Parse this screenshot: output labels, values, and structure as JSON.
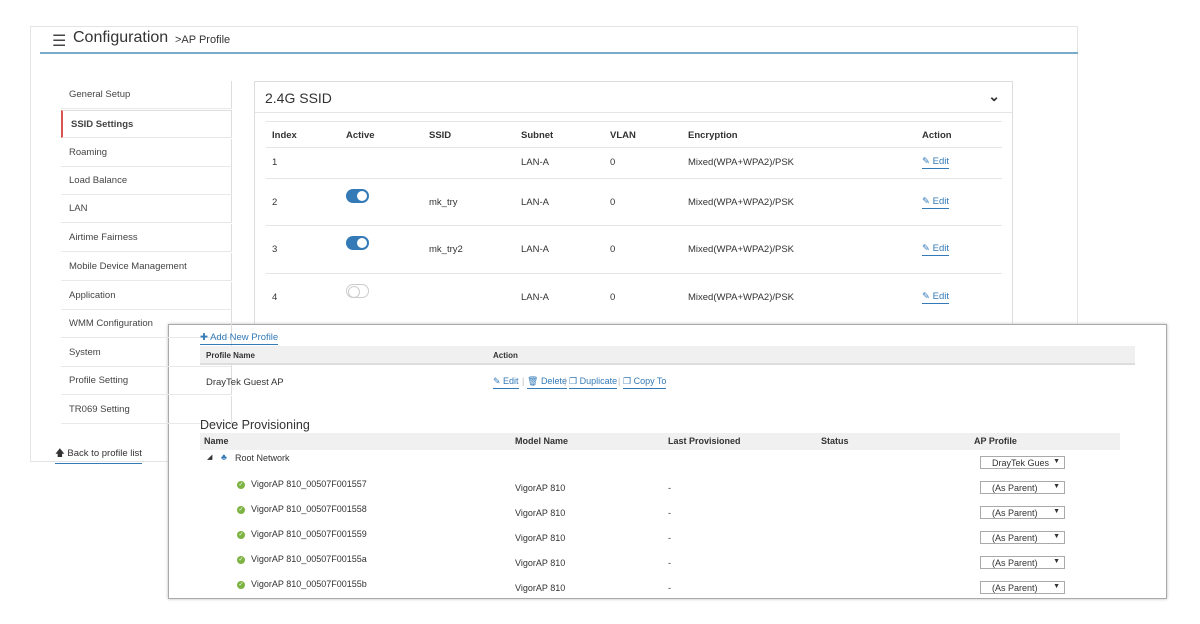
{
  "header": {
    "title": "Configuration",
    "crumb": ">AP Profile",
    "icon": "sliders-icon"
  },
  "sidebar": {
    "items": [
      "General Setup",
      "SSID Settings",
      "Roaming",
      "Load Balance",
      "LAN",
      "Airtime Fairness",
      "Mobile Device Management",
      "Application",
      "WMM Configuration",
      "System",
      "Profile Setting",
      "TR069 Setting"
    ],
    "active": 1,
    "back": "Back to profile list"
  },
  "ssid": {
    "title": "2.4G SSID",
    "columns": [
      "Index",
      "Active",
      "SSID",
      "Subnet",
      "VLAN",
      "Encryption",
      "Action"
    ],
    "rows": [
      {
        "index": "1",
        "active": null,
        "ssid": "",
        "subnet": "LAN-A",
        "vlan": "0",
        "enc": "Mixed(WPA+WPA2)/PSK",
        "action": "Edit"
      },
      {
        "index": "2",
        "active": true,
        "ssid": "mk_try",
        "subnet": "LAN-A",
        "vlan": "0",
        "enc": "Mixed(WPA+WPA2)/PSK",
        "action": "Edit"
      },
      {
        "index": "3",
        "active": true,
        "ssid": "mk_try2",
        "subnet": "LAN-A",
        "vlan": "0",
        "enc": "Mixed(WPA+WPA2)/PSK",
        "action": "Edit"
      },
      {
        "index": "4",
        "active": false,
        "ssid": "",
        "subnet": "LAN-A",
        "vlan": "0",
        "enc": "Mixed(WPA+WPA2)/PSK",
        "action": "Edit"
      }
    ]
  },
  "profiles": {
    "add": "Add New Profile",
    "columns": [
      "Profile Name",
      "Action"
    ],
    "rows": [
      {
        "name": "DrayTek Guest AP",
        "actions": [
          "Edit",
          "Delete",
          "Duplicate",
          "Copy To"
        ]
      }
    ]
  },
  "provisioning": {
    "title": "Device Provisioning",
    "columns": [
      "Name",
      "Model Name",
      "Last Provisioned",
      "Status",
      "AP Profile"
    ],
    "root": {
      "name": "Root Network",
      "profile": "DrayTek Gues"
    },
    "devices": [
      {
        "name": "VigorAP 810_00507F001557",
        "model": "VigorAP 810",
        "last": "-",
        "status": "",
        "profile": "(As Parent)"
      },
      {
        "name": "VigorAP 810_00507F001558",
        "model": "VigorAP 810",
        "last": "-",
        "status": "",
        "profile": "(As Parent)"
      },
      {
        "name": "VigorAP 810_00507F001559",
        "model": "VigorAP 810",
        "last": "-",
        "status": "",
        "profile": "(As Parent)"
      },
      {
        "name": "VigorAP 810_00507F00155a",
        "model": "VigorAP 810",
        "last": "-",
        "status": "",
        "profile": "(As Parent)"
      },
      {
        "name": "VigorAP 810_00507F00155b",
        "model": "VigorAP 810",
        "last": "-",
        "status": "",
        "profile": "(As Parent)"
      }
    ]
  },
  "colors": {
    "accent": "#337ab7",
    "active_marker": "#d9534f",
    "ok": "#7cb342"
  }
}
